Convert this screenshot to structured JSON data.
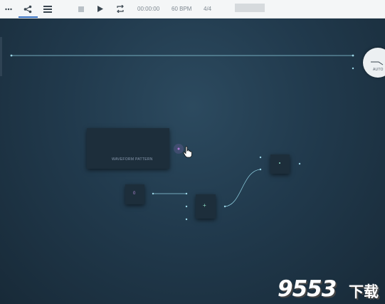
{
  "toolbar": {
    "time": "00:00:00",
    "tempo": "60 BPM",
    "meter": "4/4"
  },
  "canvas": {
    "automation_knob_label": "AUTO",
    "pattern_node_label": "WAVEFORM PATTERN",
    "value_node_label": "0"
  },
  "watermark": {
    "number": "9553",
    "suffix": "下载"
  },
  "colors": {
    "toolbar_bg": "#f4f6f7",
    "canvas_bg": "#213a4d",
    "wire": "#9bd6e6",
    "accent": "#3a74c4",
    "cursor_glow": "#b07ad8"
  }
}
